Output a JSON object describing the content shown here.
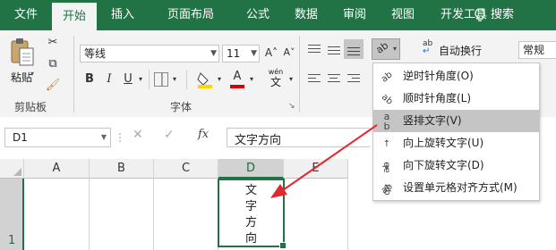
{
  "tabs": [
    {
      "label": "文件",
      "active": false
    },
    {
      "label": "开始",
      "active": true
    },
    {
      "label": "插入",
      "active": false
    },
    {
      "label": "页面布局",
      "active": false
    },
    {
      "label": "公式",
      "active": false
    },
    {
      "label": "数据",
      "active": false
    },
    {
      "label": "审阅",
      "active": false
    },
    {
      "label": "视图",
      "active": false
    },
    {
      "label": "开发工具",
      "active": false
    }
  ],
  "search": {
    "label": "搜索",
    "icon": "lightbulb-icon"
  },
  "clipboard": {
    "paste_label": "粘贴",
    "group_label": "剪贴板"
  },
  "font": {
    "name": "等线",
    "size": "11",
    "bold": "B",
    "italic": "I",
    "underline": "U",
    "increase_size": "A˄",
    "decrease_size": "A˅",
    "phonetic": "wén",
    "phonetic_char": "文",
    "font_color_glyph": "A",
    "group_label": "字体",
    "fill_color": "#ffd400",
    "font_color": "#d60000"
  },
  "alignment": {
    "wrap_text_label": "自动换行",
    "wrap_icon_text": "ab"
  },
  "number": {
    "format": "常规"
  },
  "formula_bar": {
    "name_box": "D1",
    "fx": "fx",
    "content": "文字方向",
    "cancel": "✕",
    "enter": "✓"
  },
  "grid": {
    "columns": [
      "A",
      "B",
      "C",
      "D",
      "E"
    ],
    "selected_column": "D",
    "row_number": "1",
    "cell_text_vertical": [
      "文",
      "字",
      "方",
      "向"
    ]
  },
  "orientation_menu": {
    "items": [
      {
        "label": "逆时针角度(O)",
        "icon": "ab↗",
        "highlighted": false
      },
      {
        "label": "顺时针角度(L)",
        "icon": "ab↘",
        "highlighted": false
      },
      {
        "label": "竖排文字(V)",
        "icon": "↓b",
        "highlighted": true
      },
      {
        "label": "向上旋转文字(U)",
        "icon": "↑b",
        "highlighted": false
      },
      {
        "label": "向下旋转文字(D)",
        "icon": "↓b",
        "highlighted": false
      },
      {
        "label": "设置单元格对齐方式(M)",
        "icon": "ab⇲",
        "highlighted": false
      }
    ]
  },
  "colors": {
    "brand": "#217346",
    "arrow": "#e0282e",
    "selection": "#217346"
  }
}
